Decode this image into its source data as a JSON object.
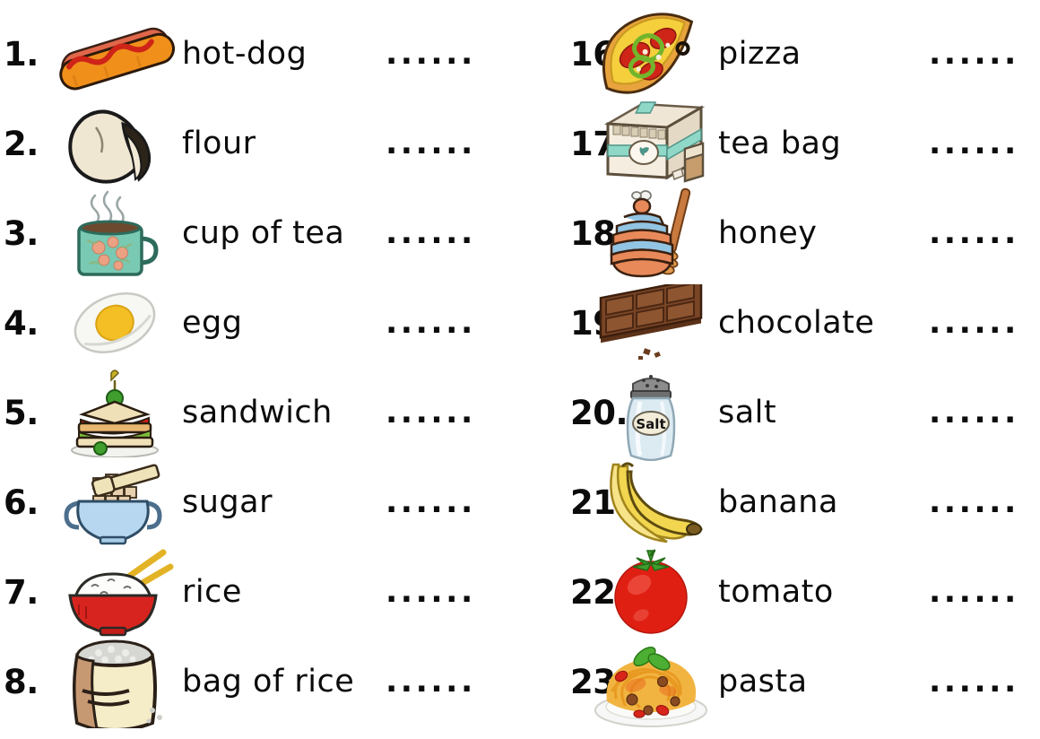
{
  "worksheet": {
    "background_color": "#ffffff",
    "text_color": "#0b0b0b",
    "answer_blank": "......",
    "columns": [
      {
        "name": "left-column",
        "items": [
          {
            "number": "1.",
            "label": "hot-dog",
            "icon": "hot-dog-icon",
            "blank": "......"
          },
          {
            "number": "2.",
            "label": "flour",
            "icon": "flour-bag-icon",
            "blank": "......"
          },
          {
            "number": "3.",
            "label": "cup of tea",
            "icon": "tea-cup-icon",
            "blank": "......"
          },
          {
            "number": "4.",
            "label": "egg",
            "icon": "egg-icon",
            "blank": "......"
          },
          {
            "number": "5.",
            "label": "sandwich",
            "icon": "sandwich-icon",
            "blank": "......"
          },
          {
            "number": "6.",
            "label": "sugar",
            "icon": "sugar-bowl-icon",
            "blank": "......"
          },
          {
            "number": "7.",
            "label": "rice",
            "icon": "rice-bowl-icon",
            "blank": "......"
          },
          {
            "number": "8.",
            "label": "bag of rice",
            "icon": "rice-sack-icon",
            "blank": "......"
          }
        ]
      },
      {
        "name": "right-column",
        "items": [
          {
            "number": "16.",
            "label": "pizza",
            "icon": "pizza-slice-icon",
            "blank": "......"
          },
          {
            "number": "17.",
            "label": "tea bag",
            "icon": "tea-bag-box-icon",
            "blank": "......"
          },
          {
            "number": "18.",
            "label": "honey",
            "icon": "honey-jar-icon",
            "blank": "......"
          },
          {
            "number": "19.",
            "label": "chocolate",
            "icon": "chocolate-bar-icon",
            "blank": "......"
          },
          {
            "number": "20.",
            "label": "salt",
            "icon": "salt-shaker-icon",
            "blank": "......"
          },
          {
            "number": "21.",
            "label": "banana",
            "icon": "banana-icon",
            "blank": "......"
          },
          {
            "number": "22.",
            "label": "tomato",
            "icon": "tomato-icon",
            "blank": "......"
          },
          {
            "number": "23.",
            "label": "pasta",
            "icon": "pasta-plate-icon",
            "blank": "......"
          }
        ]
      }
    ],
    "icon_text": {
      "salt_shaker_label": "Salt"
    },
    "palette": {
      "hotdog_bun": "#f0901b",
      "hotdog_sausage": "#e0674a",
      "ketchup": "#cf2418",
      "flour_bag": "#efe7d2",
      "tea_mug": "#79c9b3",
      "tea_liquid": "#6b4a2f",
      "egg_white": "#f5f5f2",
      "egg_yolk": "#f4bf25",
      "bread": "#e8b771",
      "sugar_bowl": "#b6d7ef",
      "sugar_cube": "#e8cfae",
      "rice_bowl": "#d8241f",
      "rice_white": "#fdfdfb",
      "chopstick": "#e2b326",
      "sack_tan": "#f5ecc8",
      "sack_brown": "#c79973",
      "pizza_crust": "#e8a33d",
      "pizza_cheese": "#f5cf3c",
      "pepperoni": "#cf2418",
      "pepper_green": "#72b52c",
      "box_cardboard": "#efe6d6",
      "box_stripe": "#8fd8c8",
      "honey_pot": "#e8895a",
      "honey_band": "#92c4e3",
      "dipper_wood": "#c97a3f",
      "chocolate": "#7a4526",
      "chocolate_dark": "#5c3219",
      "shaker_glass": "#dceaf2",
      "shaker_cap": "#6e6e6e",
      "banana_yellow": "#f2d64f",
      "tomato_red": "#e01f13",
      "tomato_leaf": "#3f9e2e",
      "pasta_noodle": "#f2b441",
      "plate_white": "#f7f7f7"
    }
  }
}
